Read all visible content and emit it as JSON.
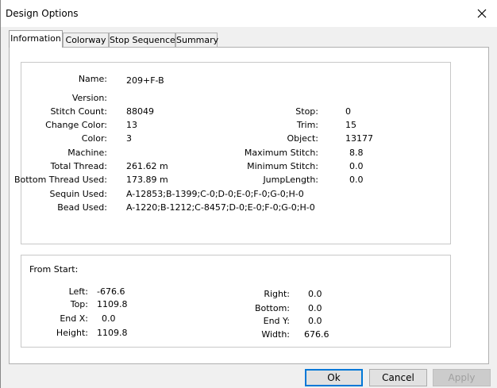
{
  "window": {
    "title": "Design Options"
  },
  "tabs": [
    {
      "label": "Information",
      "active": true
    },
    {
      "label": "Colorway",
      "active": false
    },
    {
      "label": "Stop Sequence",
      "active": false
    },
    {
      "label": "Summary",
      "active": false
    }
  ],
  "info": {
    "name_label": "Name:",
    "name_value": "209+F-B",
    "version_label": "Version:",
    "version_value": "",
    "stitch_count_label": "Stitch Count:",
    "stitch_count_value": "88049",
    "change_color_label": "Change Color:",
    "change_color_value": "13",
    "color_label": "Color:",
    "color_value": "3",
    "machine_label": "Machine:",
    "machine_value": "",
    "total_thread_label": "Total Thread:",
    "total_thread_value": "261.62 m",
    "bottom_thread_label": "Bottom Thread Used:",
    "bottom_thread_value": "173.89 m",
    "sequin_label": "Sequin Used:",
    "sequin_value": "A-12853;B-1399;C-0;D-0;E-0;F-0;G-0;H-0",
    "bead_label": "Bead Used:",
    "bead_value": "A-1220;B-1212;C-8457;D-0;E-0;F-0;G-0;H-0",
    "stop_label": "Stop:",
    "stop_value": "0",
    "trim_label": "Trim:",
    "trim_value": "15",
    "object_label": "Object:",
    "object_value": "13177",
    "max_stitch_label": "Maximum Stitch:",
    "max_stitch_value": "8.8",
    "min_stitch_label": "Minimum Stitch:",
    "min_stitch_value": "0.0",
    "jump_length_label": "JumpLength:",
    "jump_length_value": "0.0"
  },
  "from_start": {
    "heading": "From Start:",
    "left_label": "Left:",
    "left_value": "-676.6",
    "top_label": "Top:",
    "top_value": "1109.8",
    "endx_label": "End X:",
    "endx_value": "0.0",
    "height_label": "Height:",
    "height_value": "1109.8",
    "right_label": "Right:",
    "right_value": "0.0",
    "bottom_label": "Bottom:",
    "bottom_value": "0.0",
    "endy_label": "End Y:",
    "endy_value": "0.0",
    "width_label": "Width:",
    "width_value": "676.6"
  },
  "buttons": {
    "ok": "Ok",
    "cancel": "Cancel",
    "apply": "Apply"
  },
  "icons": {
    "close": "close-icon"
  },
  "colors": {
    "default_button_border": "#0078d7",
    "panel_background": "#ffffff",
    "dialog_background": "#f0f0f0"
  }
}
